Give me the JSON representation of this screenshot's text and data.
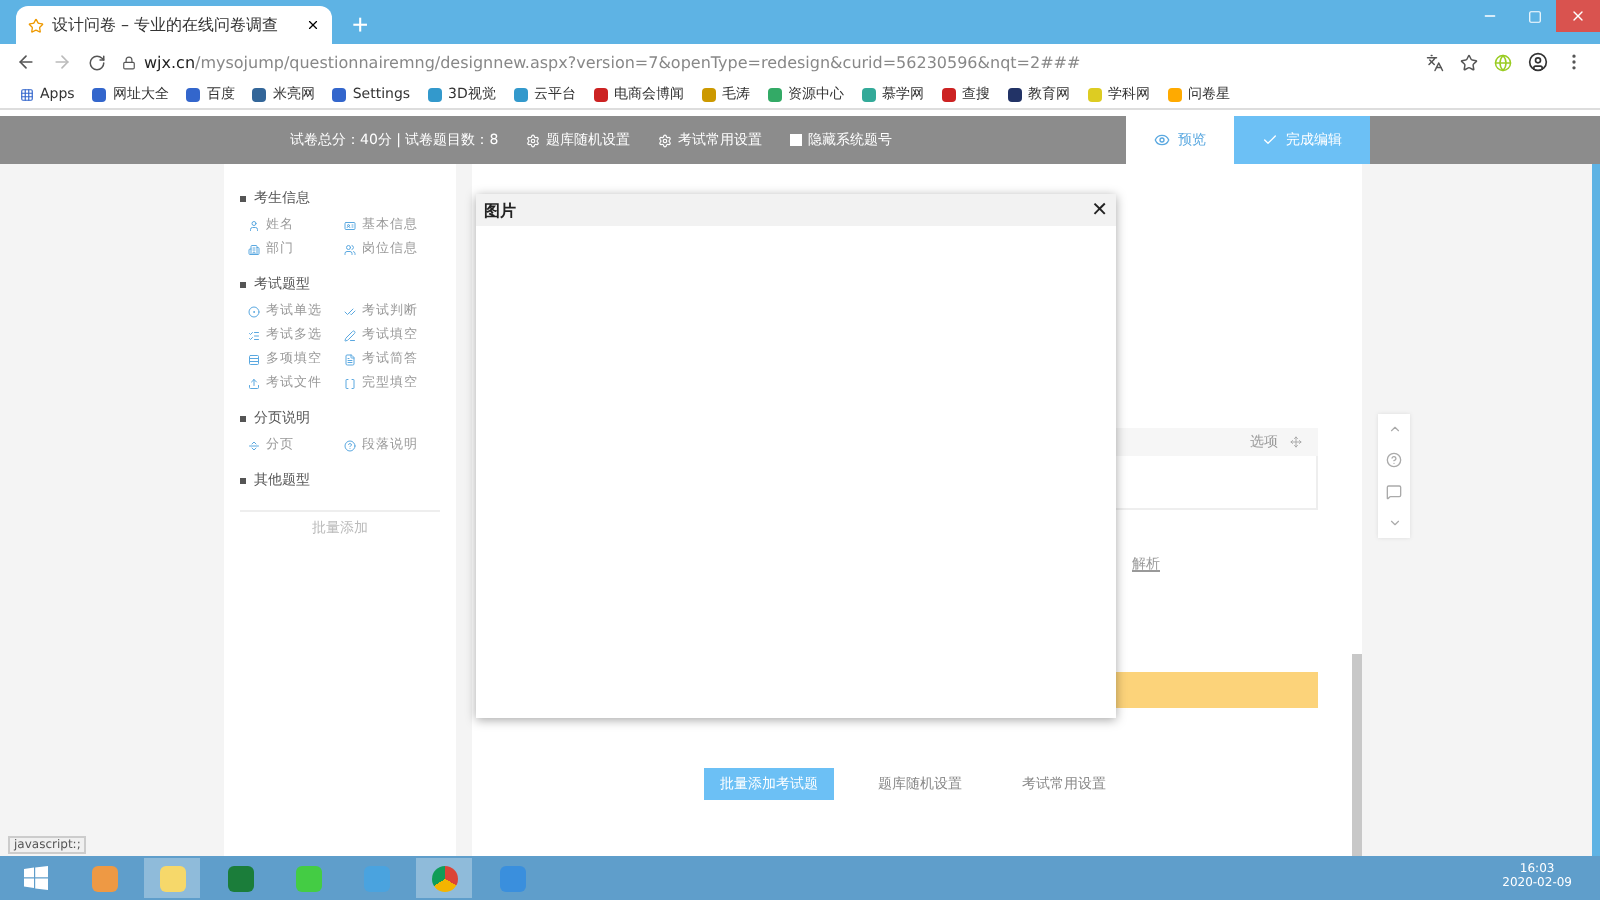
{
  "browser": {
    "tab_title": "设计问卷 – 专业的在线问卷调查",
    "new_tab": "+",
    "url_host": "wjx.cn",
    "url_path": "/mysojump/questionnairemng/designnew.aspx?version=7&openType=redesign&curid=56230596&nqt=2###",
    "bookmarks": [
      "Apps",
      "网址大全",
      "百度",
      "米亮网",
      "Settings",
      "3D视觉",
      "云平台",
      "电商会博闻",
      "毛涛",
      "资源中心",
      "慕学网",
      "查搜",
      "教育网",
      "学科网",
      "问卷星"
    ]
  },
  "toolbar": {
    "summary": "试卷总分：40分 | 试卷题目数：8",
    "options": [
      {
        "label": "题库随机设置",
        "kind": "gear"
      },
      {
        "label": "考试常用设置",
        "kind": "gear"
      },
      {
        "label": "隐藏系统题号",
        "kind": "checkbox",
        "checked": false
      }
    ],
    "actions": [
      {
        "label": "预览",
        "selected": false
      },
      {
        "label": "完成编辑",
        "selected": true
      }
    ]
  },
  "sidebar": {
    "groups": [
      {
        "title": "考生信息",
        "items": [
          "姓名",
          "基本信息",
          "部门",
          "岗位信息"
        ]
      },
      {
        "title": "考试题型",
        "items": [
          "考试单选",
          "考试判断",
          "考试多选",
          "考试填空",
          "多项填空",
          "考试简答",
          "考试文件",
          "完型填空"
        ]
      },
      {
        "title": "分页说明",
        "items": [
          "分页",
          "段落说明"
        ]
      },
      {
        "title": "其他题型"
      }
    ],
    "batch_add": "批量添加"
  },
  "editor": {
    "option_header": "选项",
    "analysis_link": "解析",
    "bottom_buttons": [
      {
        "label": "批量添加考试题",
        "selected": true
      },
      {
        "label": "题库随机设置",
        "selected": false
      },
      {
        "label": "考试常用设置",
        "selected": false
      }
    ]
  },
  "dialog": {
    "title": "图片",
    "close": "✕"
  },
  "status_text": "javascript:;",
  "taskbar": {
    "time": "16:03",
    "date": "2020-02-09"
  }
}
